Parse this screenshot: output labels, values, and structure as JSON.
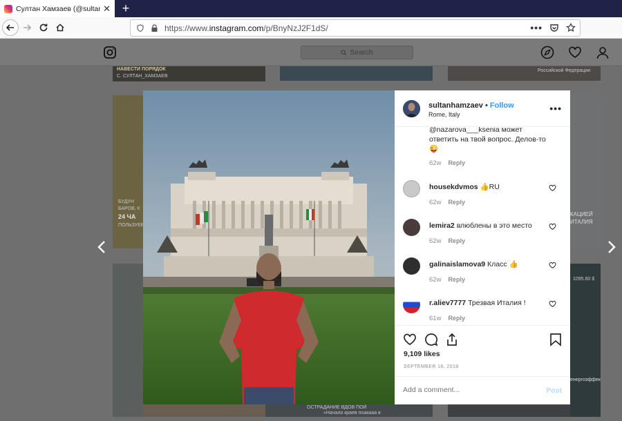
{
  "browser": {
    "tab_title": "Султан Хамзаев (@sultanham",
    "tab_close": "✕",
    "new_tab": "+",
    "url_prefix": "https://www.",
    "url_host": "instagram.com",
    "url_path": "/p/BnyNzJ2F1dS/",
    "page_actions": "•••"
  },
  "instagram": {
    "search_placeholder": "Search",
    "search_icon": "search-icon",
    "logo_icon": "instagram-logo-icon",
    "nav_icons": [
      "compass-icon",
      "heart-icon",
      "profile-icon"
    ]
  },
  "background_grid": {
    "captions": [
      "НАВЕСТИ ПОРЯДОК",
      "С. СУЛТАН_ХАМЗАЕВ",
      "Российской Федерации",
      "БУДУН",
      "БАРОВ, К",
      "24 ЧА",
      "ПОЛЬЗУЕВ",
      "КАЦИЕЙ",
      "ИТАЛИЯ",
      "1095.60 $",
      "енергоэффек",
      "ОСТРАДАНИЕ ВДОВ ПОЙ",
      "«Начало краев поакааа в",
      "По подземке сеул поготе"
    ]
  },
  "post": {
    "username": "sultanhamzaev",
    "separator": "•",
    "follow_label": "Follow",
    "location": "Rome, Italy",
    "more_label": "•••",
    "comments": [
      {
        "username": "",
        "text": "@nazarova___ksenia может ответить на твой вопрос. Делов-то 😜",
        "time": "62w",
        "reply": "Reply"
      },
      {
        "username": "housekdvmos",
        "text": "👍RU",
        "time": "62w",
        "reply": "Reply"
      },
      {
        "username": "lemira2",
        "text": "влюблены в это место",
        "time": "62w",
        "reply": "Reply"
      },
      {
        "username": "galinaislamova9",
        "text": "Класс 👍",
        "time": "62w",
        "reply": "Reply"
      },
      {
        "username": "r.aliev7777",
        "text": "Трезвая Италия !",
        "time": "61w",
        "reply": "Reply"
      }
    ],
    "likes": "9,109 likes",
    "date": "SEPTEMBER 16, 2018",
    "add_comment_placeholder": "Add a comment...",
    "post_label": "Post"
  },
  "colors": {
    "accent": "#3897f0",
    "post_disabled": "#b2dffc",
    "tab_bar": "#1f2347",
    "overlay": "#6f6f6f"
  }
}
